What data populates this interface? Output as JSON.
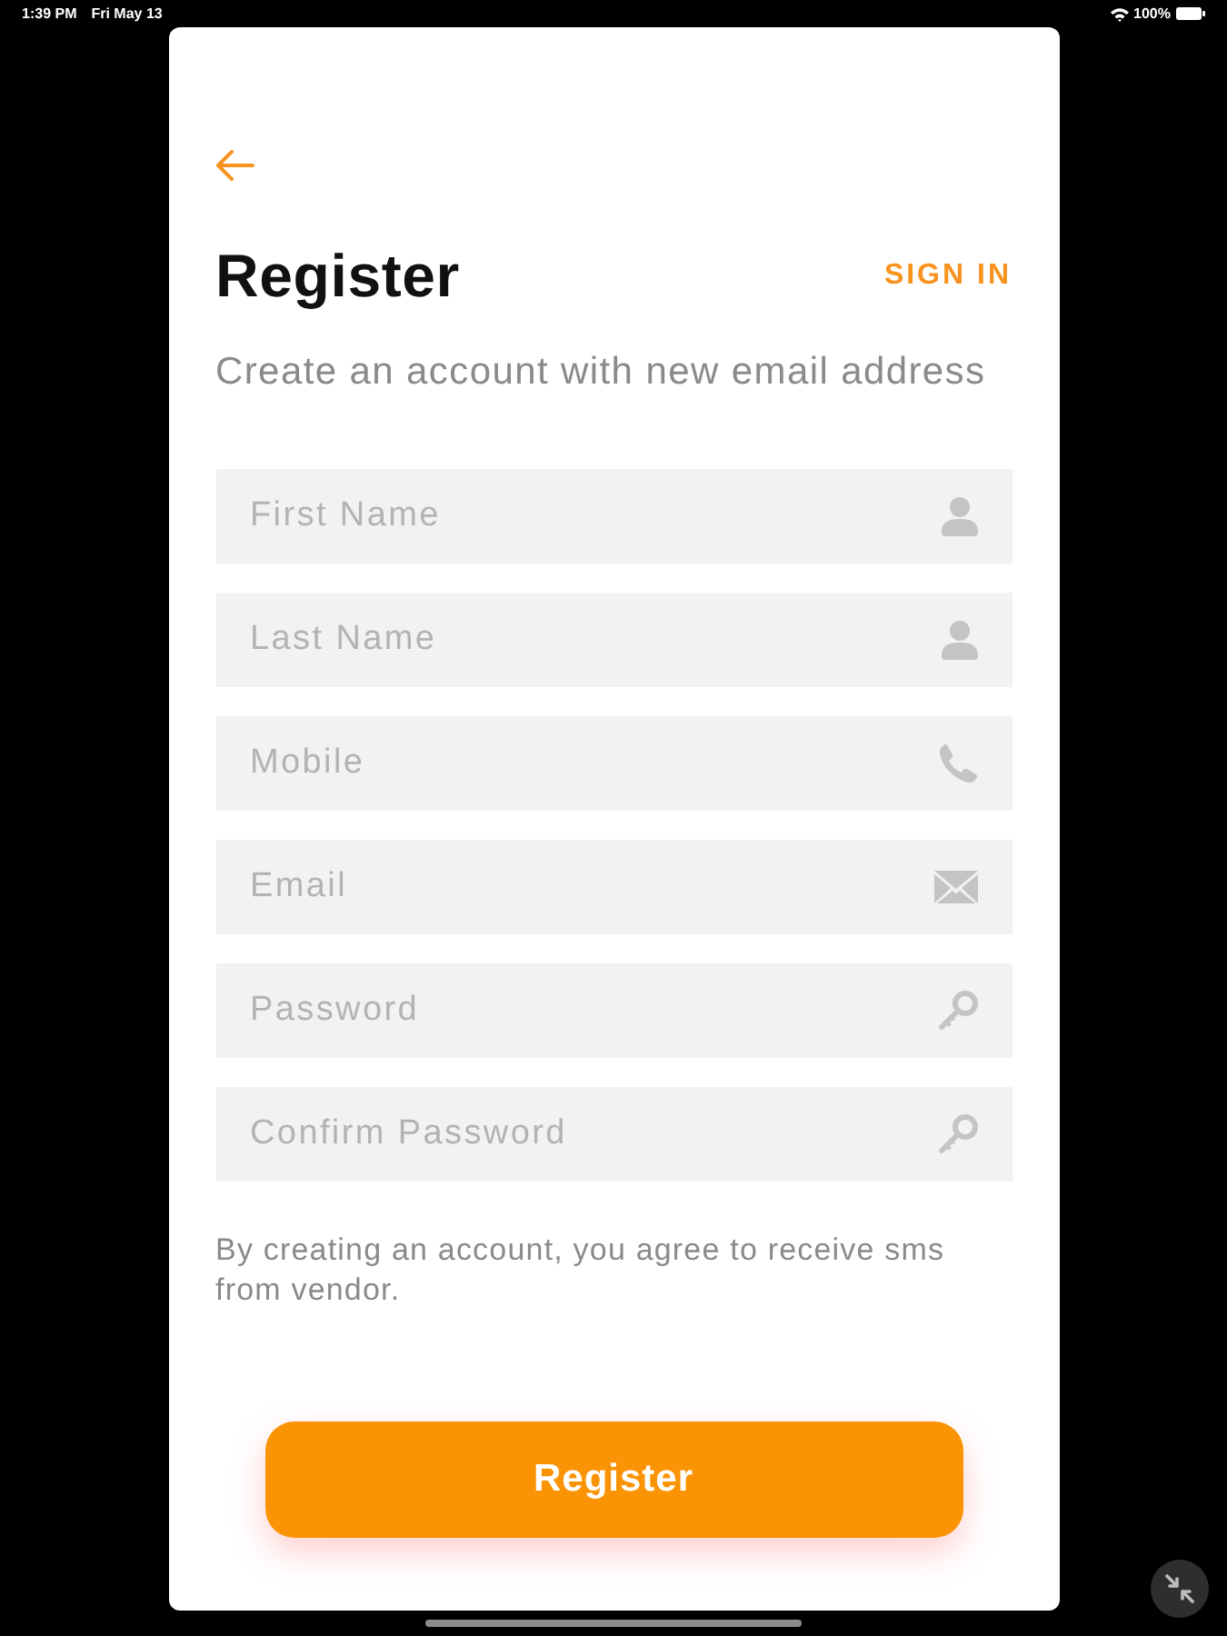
{
  "status_bar": {
    "time": "1:39 PM",
    "date": "Fri May 13",
    "battery": "100%"
  },
  "form": {
    "title": "Register",
    "sign_in_link": "SIGN IN",
    "subtitle": "Create an account with new email address",
    "fields": [
      {
        "placeholder": "First Name",
        "kind": "person"
      },
      {
        "placeholder": "Last Name",
        "kind": "person"
      },
      {
        "placeholder": "Mobile",
        "kind": "phone"
      },
      {
        "placeholder": "Email",
        "kind": "email"
      },
      {
        "placeholder": "Password",
        "kind": "key"
      },
      {
        "placeholder": "Confirm Password",
        "kind": "key"
      }
    ],
    "terms": "By creating an account, you agree to receive sms from vendor.",
    "submit_button": "Register"
  }
}
